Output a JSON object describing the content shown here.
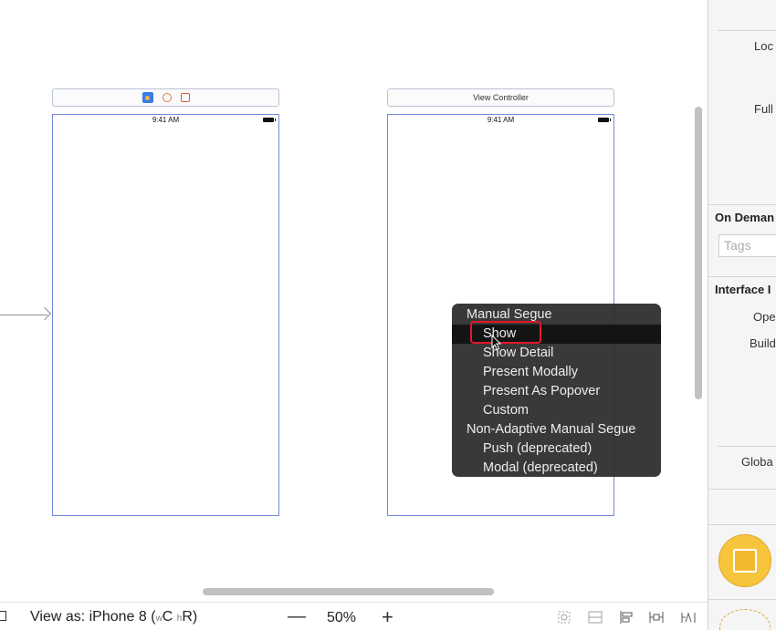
{
  "canvas": {
    "scene1": {
      "status_time": "9:41 AM"
    },
    "scene2": {
      "title": "View Controller",
      "status_time": "9:41 AM"
    }
  },
  "segue_menu": {
    "header1": "Manual Segue",
    "items1": [
      "Show",
      "Show Detail",
      "Present Modally",
      "Present As Popover",
      "Custom"
    ],
    "header2": "Non-Adaptive Manual Segue",
    "items2": [
      "Push (deprecated)",
      "Modal (deprecated)"
    ],
    "selected": "Show"
  },
  "bottom_bar": {
    "view_as_prefix": "View as: iPhone 8 (",
    "w_small": "w",
    "w_class": "C ",
    "h_small": "h",
    "h_class": "R",
    "view_as_suffix": ")",
    "zoom_out": "—",
    "zoom": "50%",
    "zoom_in": "+"
  },
  "inspector": {
    "localization_label": "Loc",
    "full_label": "Full",
    "on_demand_header": "On Deman",
    "tags_placeholder": "Tags",
    "interface_header": "Interface I",
    "opens_label": "Ope",
    "builds_label": "Build",
    "global_label": "Globa"
  },
  "colors": {
    "scene_border": "#7389dc",
    "menu_bg": "#2a2a2a",
    "highlight": "#e2182a",
    "library_icon": "#f6c53b"
  }
}
